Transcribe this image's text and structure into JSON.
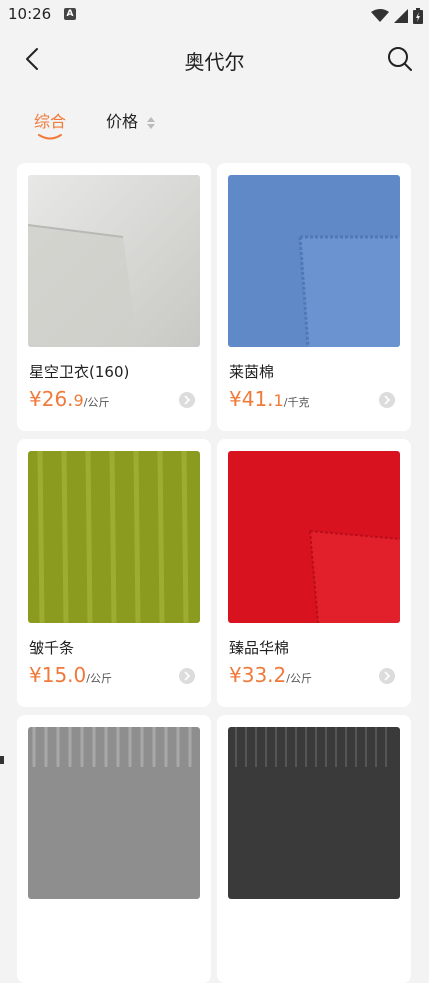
{
  "status": {
    "time": "10:26",
    "badge": "A"
  },
  "nav": {
    "title": "奥代尔"
  },
  "sort": {
    "tabs": [
      {
        "label": "综合",
        "active": true
      },
      {
        "label": "价格",
        "active": false
      }
    ]
  },
  "products": [
    {
      "name": "星空卫衣(160)",
      "currency": "¥",
      "price_int": "26.",
      "price_dec": "9",
      "unit": "/公斤",
      "thumb_color": "#d7d7d3"
    },
    {
      "name": "莱茵棉",
      "currency": "¥",
      "price_int": "41.",
      "price_dec": "1",
      "unit": "/千克",
      "thumb_color": "#5f89c7"
    },
    {
      "name": "皱千条",
      "currency": "¥",
      "price_int": "15.",
      "price_dec": "0",
      "unit": "/公斤",
      "thumb_color": "#8b9b1f"
    },
    {
      "name": "臻品华棉",
      "currency": "¥",
      "price_int": "33.",
      "price_dec": "2",
      "unit": "/公斤",
      "thumb_color": "#d9121f"
    },
    {
      "name": "",
      "currency": "",
      "price_int": "",
      "price_dec": "",
      "unit": "",
      "thumb_color": "#8e8e8e"
    },
    {
      "name": "",
      "currency": "",
      "price_int": "",
      "price_dec": "",
      "unit": "",
      "thumb_color": "#3a3a3a"
    }
  ],
  "colors": {
    "accent": "#f07a3a",
    "background": "#f3f3f3",
    "card": "#ffffff"
  }
}
